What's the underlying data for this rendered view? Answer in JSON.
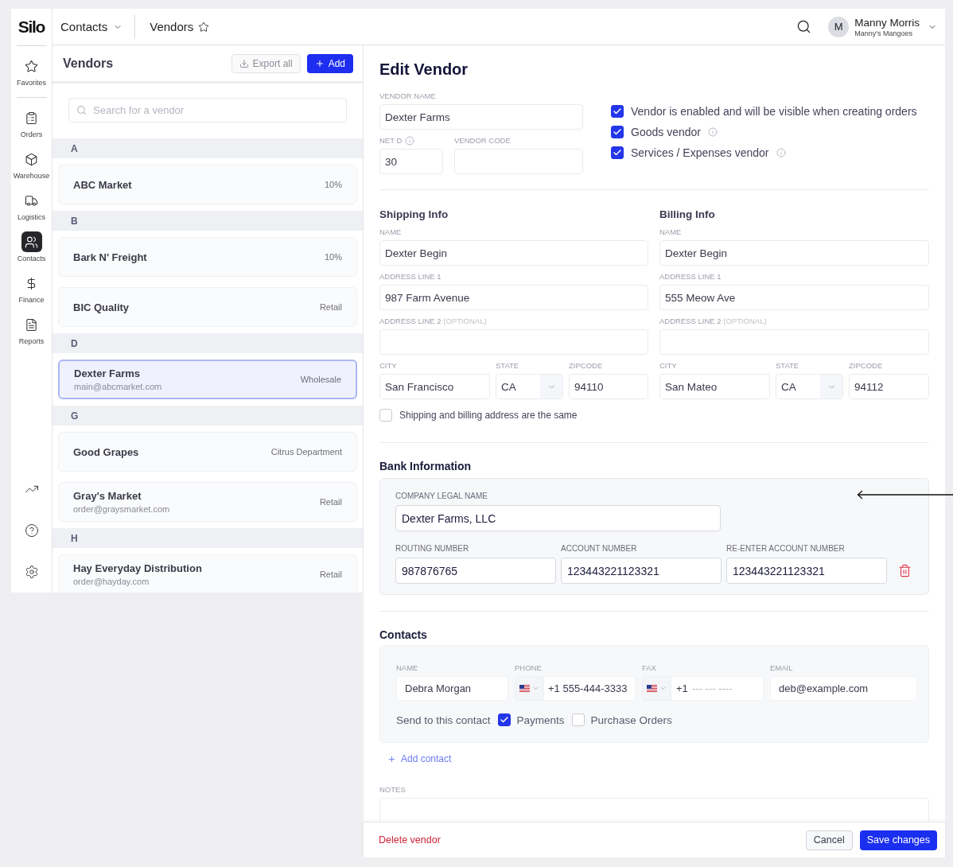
{
  "sidebar": {
    "logo": "Silo",
    "items": [
      {
        "label": "Favorites",
        "selected": false
      },
      {
        "label": "Orders",
        "selected": false
      },
      {
        "label": "Warehouse",
        "selected": false
      },
      {
        "label": "Logistics",
        "selected": false
      },
      {
        "label": "Contacts",
        "selected": true
      },
      {
        "label": "Finance",
        "selected": false
      },
      {
        "label": "Reports",
        "selected": false
      }
    ]
  },
  "topbar": {
    "section": "Contacts",
    "page": "Vendors",
    "page_starred": false,
    "user": {
      "initial": "M",
      "name": "Manny Morris",
      "company": "Manny's Mangoes"
    }
  },
  "vendor_list": {
    "title": "Vendors",
    "export_label": "Export all",
    "add_label": "Add",
    "search": {
      "placeholder": "Search for a vendor"
    },
    "groups": [
      {
        "letter": "A",
        "vendors": [
          {
            "name": "ABC Market",
            "tag": "10%",
            "selected": false
          }
        ]
      },
      {
        "letter": "B",
        "vendors": [
          {
            "name": "Bark N' Freight",
            "tag": "10%",
            "selected": false
          },
          {
            "name": "BIC Quality",
            "tag": "Retail",
            "selected": false
          }
        ]
      },
      {
        "letter": "D",
        "vendors": [
          {
            "name": "Dexter Farms",
            "email": "main@abcmarket.com",
            "tag": "Wholesale",
            "selected": true
          }
        ]
      },
      {
        "letter": "G",
        "vendors": [
          {
            "name": "Good Grapes",
            "tag": "Citrus Department",
            "selected": false
          },
          {
            "name": "Gray's Market",
            "email": "order@graysmarket.com",
            "tag": "Retail",
            "selected": false
          }
        ]
      },
      {
        "letter": "H",
        "vendors": [
          {
            "name": "Hay Everyday Distribution",
            "email": "order@hayday.com",
            "tag": "Retail",
            "selected": false
          }
        ]
      }
    ]
  },
  "edit_vendor": {
    "title": "Edit Vendor",
    "vendor_name": {
      "label": "VENDOR NAME",
      "value": "Dexter Farms"
    },
    "net_d": {
      "label": "NET D",
      "value": "30",
      "info": true
    },
    "vendor_code": {
      "label": "VENDOR CODE"
    },
    "options": [
      {
        "label": "Vendor is enabled and will be visible when creating orders",
        "checked": true,
        "info": false
      },
      {
        "label": "Goods vendor",
        "checked": true,
        "info": true
      },
      {
        "label": "Services / Expenses vendor",
        "checked": true,
        "info": true
      }
    ],
    "addresses": [
      {
        "heading": "Shipping Info",
        "name": {
          "label": "NAME",
          "value": "Dexter Begin"
        },
        "address_line_1": {
          "label": "ADDRESS LINE 1",
          "value": "987 Farm Avenue"
        },
        "address_line_2": {
          "label": "ADDRESS LINE 2",
          "hint": "(OPTIONAL)"
        },
        "city": {
          "label": "CITY",
          "value": "San Francisco"
        },
        "state": {
          "label": "STATE",
          "value": "CA"
        },
        "zipcode": {
          "label": "ZIPCODE",
          "value": "94110"
        }
      },
      {
        "heading": "Billing Info",
        "name": {
          "label": "NAME",
          "value": "Dexter Begin"
        },
        "address_line_1": {
          "label": "ADDRESS LINE 1",
          "value": "555 Meow Ave"
        },
        "address_line_2": {
          "label": "ADDRESS LINE 2",
          "hint": "(OPTIONAL)"
        },
        "city": {
          "label": "CITY",
          "value": "San Mateo"
        },
        "state": {
          "label": "STATE",
          "value": "CA"
        },
        "zipcode": {
          "label": "ZIPCODE",
          "value": "94112"
        }
      }
    ],
    "same_address": {
      "label": "Shipping and billing address are the same",
      "checked": false
    },
    "bank": {
      "heading": "Bank Information",
      "company_legal_name": {
        "label": "COMPANY LEGAL NAME",
        "value": "Dexter Farms, LLC"
      },
      "accounts": [
        {
          "label": "ROUTING NUMBER",
          "value": "987876765"
        },
        {
          "label": "ACCOUNT NUMBER",
          "value": "123443221123321"
        },
        {
          "label": "RE-ENTER ACCOUNT NUMBER",
          "value": "123443221123321"
        }
      ]
    },
    "contacts": {
      "heading": "Contacts",
      "items": [
        {
          "name": {
            "label": "NAME",
            "value": "Debra Morgan"
          },
          "phone": {
            "label": "PHONE",
            "value": "+1 555-444-3333"
          },
          "fax": {
            "label": "FAX",
            "prefix": "+1",
            "placeholder": "--- --- ----"
          },
          "email": {
            "label": "EMAIL",
            "value": "deb@example.com"
          },
          "send_label": "Send to this contact",
          "send_to": [
            {
              "label": "Payments",
              "checked": true
            },
            {
              "label": "Purchase Orders",
              "checked": false
            }
          ]
        }
      ],
      "add_label": "Add contact"
    },
    "notes": {
      "label": "NOTES"
    }
  },
  "footer": {
    "delete_label": "Delete vendor",
    "cancel_label": "Cancel",
    "save_label": "Save changes"
  }
}
